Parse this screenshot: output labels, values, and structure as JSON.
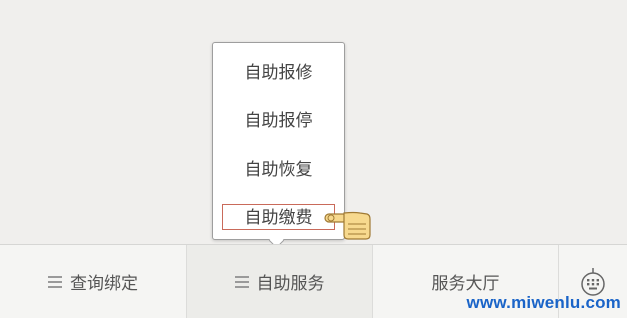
{
  "popup_menu": {
    "items": [
      {
        "label": "自助报修"
      },
      {
        "label": "自助报停"
      },
      {
        "label": "自助恢复"
      },
      {
        "label": "自助缴费"
      }
    ],
    "highlighted_index": 3
  },
  "bottom_bar": {
    "tabs": [
      {
        "label": "查询绑定",
        "icon": "menu-lines-icon"
      },
      {
        "label": "自助服务",
        "icon": "menu-lines-icon"
      },
      {
        "label": "服务大厅"
      }
    ],
    "keyboard_icon": "keyboard-icon"
  },
  "cursor_icon": "pointing-hand-icon",
  "watermark": "www.miwenlu.com",
  "colors": {
    "highlight_border": "#c96a5a",
    "watermark": "#1a64c8",
    "hand_fill": "#f7d98e"
  }
}
